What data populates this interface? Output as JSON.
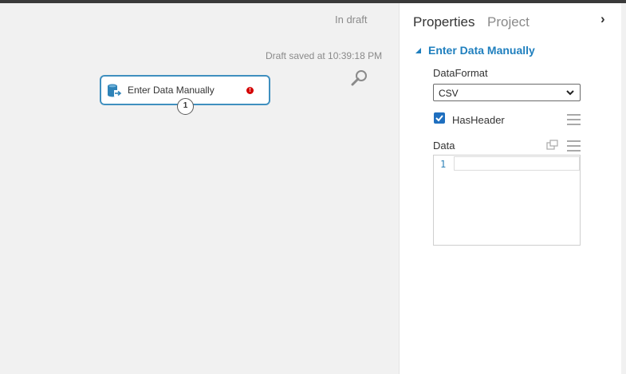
{
  "canvas": {
    "status": "In draft",
    "saved_message": "Draft saved at 10:39:18 PM",
    "module": {
      "label": "Enter Data Manually",
      "warning_symbol": "!",
      "output_port_label": "1"
    },
    "icons": {
      "zoom": "magnifier-icon",
      "module": "dataset-icon",
      "warning": "error-icon"
    }
  },
  "panel": {
    "tabs": [
      {
        "label": "Properties",
        "active": true
      },
      {
        "label": "Project",
        "active": false
      }
    ],
    "collapse_symbol": "›",
    "section_title": "Enter Data Manually",
    "data_format": {
      "label": "DataFormat",
      "value": "CSV"
    },
    "has_header": {
      "label": "HasHeader",
      "checked": true
    },
    "data": {
      "label": "Data",
      "line_number": "1",
      "content": ""
    }
  },
  "colors": {
    "accent": "#1f7fbe",
    "module_border": "#3f8fbf",
    "warning": "#d40000",
    "checkbox": "#1f6fbf"
  }
}
